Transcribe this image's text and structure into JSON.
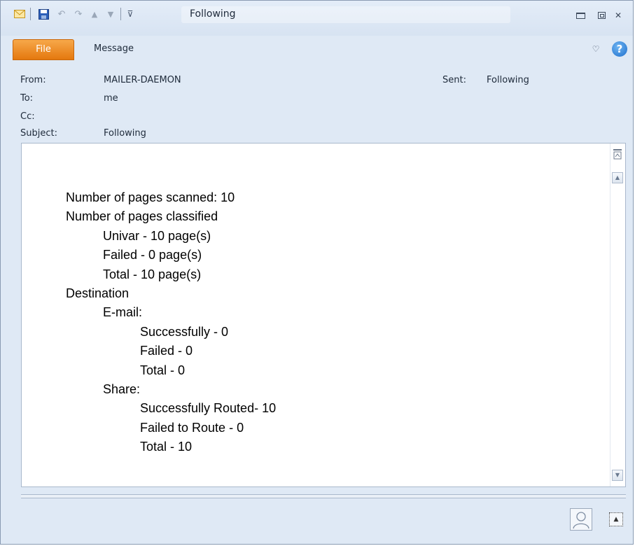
{
  "window": {
    "title": "Following",
    "controls": {
      "minimize": "▭",
      "maximize": "▣",
      "close": "✕"
    }
  },
  "quick_access": {
    "icons": [
      "mail-icon",
      "save-icon",
      "undo-icon",
      "redo-icon",
      "up-arrow-icon",
      "down-arrow-icon",
      "customize-dropdown-icon"
    ]
  },
  "ribbon": {
    "file_tab": "File",
    "message_tab": "Message",
    "help": "?"
  },
  "header": {
    "from_label": "From:",
    "from_value": "MAILER-DAEMON",
    "to_label": "To:",
    "to_value": "me",
    "cc_label": "Cc:",
    "cc_value": "",
    "subject_label": "Subject:",
    "subject_value": "Following",
    "sent_label": "Sent:",
    "sent_value": "Following"
  },
  "body": {
    "lines": [
      {
        "text": "Number of pages scanned: 10",
        "indent": 0
      },
      {
        "text": "Number of pages classified",
        "indent": 0
      },
      {
        "text": "Univar - 10 page(s)",
        "indent": 1
      },
      {
        "text": "Failed - 0 page(s)",
        "indent": 1
      },
      {
        "text": "Total - 10 page(s)",
        "indent": 1
      },
      {
        "text": "Destination",
        "indent": 0
      },
      {
        "text": "E-mail:",
        "indent": 1
      },
      {
        "text": "Successfully - 0",
        "indent": 2
      },
      {
        "text": "Failed - 0",
        "indent": 2
      },
      {
        "text": "Total - 0",
        "indent": 2
      },
      {
        "text": "Share:",
        "indent": 1
      },
      {
        "text": "Successfully Routed- 10",
        "indent": 2
      },
      {
        "text": "Failed to Route - 0",
        "indent": 2
      },
      {
        "text": "Total - 10",
        "indent": 2
      }
    ]
  },
  "colors": {
    "file_tab": "#e4780e",
    "window_bg": "#dfe9f5",
    "help_button": "#1f6fcc"
  }
}
